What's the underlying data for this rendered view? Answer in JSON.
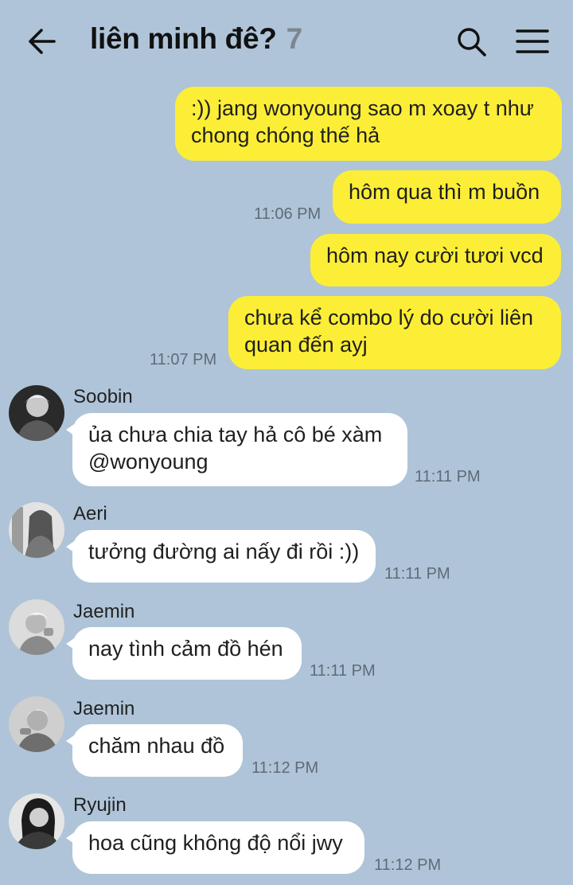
{
  "header": {
    "title": "liên minh đê?",
    "member_count": "7",
    "icons": [
      "back-arrow-icon",
      "search-icon",
      "menu-icon"
    ]
  },
  "messages": [
    {
      "side": "out",
      "lines": [
        ":)) jang wonyoung sao m xoay t như",
        "chong chóng thế hả"
      ],
      "time": ""
    },
    {
      "side": "out",
      "lines": [
        "hôm qua thì m buồn"
      ],
      "time": "11:06 PM"
    },
    {
      "side": "out",
      "lines": [
        "hôm nay cười tươi vcd"
      ],
      "time": ""
    },
    {
      "side": "out",
      "lines": [
        "chưa kể combo lý do cười liên",
        "quan đến ayj"
      ],
      "time": "11:07 PM"
    },
    {
      "side": "in",
      "sender": "Soobin",
      "lines": [
        "ủa chưa chia tay hả cô bé xàm",
        "@wonyoung"
      ],
      "time": "11:11 PM"
    },
    {
      "side": "in",
      "sender": "Aeri",
      "lines": [
        "tưởng đường ai nấy đi rồi :))"
      ],
      "time": "11:11 PM"
    },
    {
      "side": "in",
      "sender": "Jaemin",
      "lines": [
        "nay tình cảm đồ hén"
      ],
      "time": "11:11 PM"
    },
    {
      "side": "in",
      "sender": "Jaemin",
      "lines": [
        "chăm nhau đồ"
      ],
      "time": "11:12 PM"
    },
    {
      "side": "in",
      "sender": "Ryujin",
      "lines": [
        "hoa cũng không độ nổi jwy"
      ],
      "time": "11:12 PM"
    }
  ],
  "colors": {
    "background": "#afc4d8",
    "outgoing_bubble": "#fcee36",
    "incoming_bubble": "#ffffff",
    "timestamp": "#5f6b77",
    "member_count": "#7b8691"
  }
}
